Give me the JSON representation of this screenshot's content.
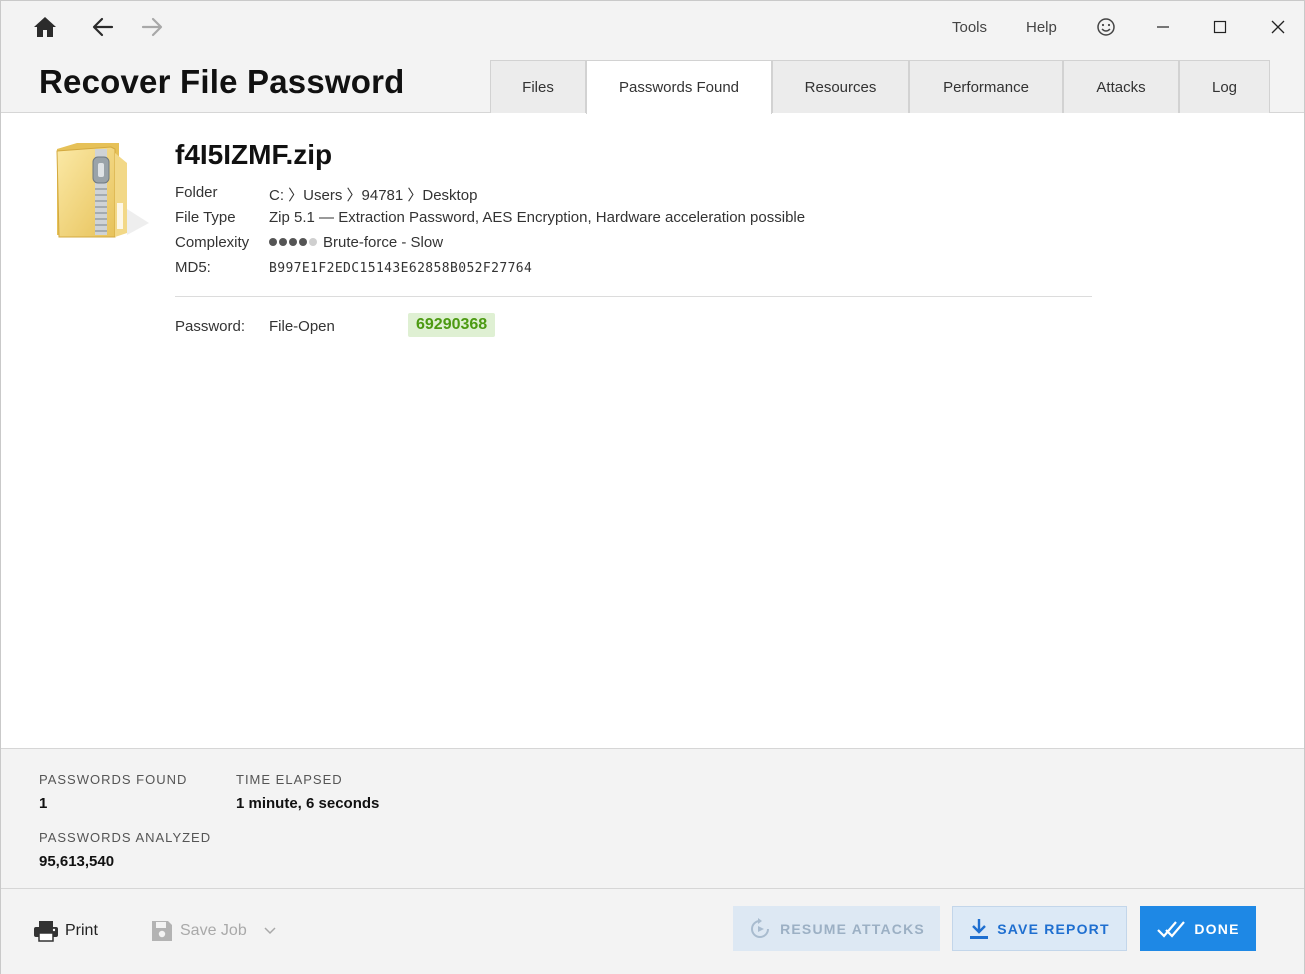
{
  "app": {
    "title": "Recover File Password",
    "menu": {
      "tools": "Tools",
      "help": "Help"
    }
  },
  "tabs": [
    {
      "label": "Files",
      "active": false
    },
    {
      "label": "Passwords Found",
      "active": true
    },
    {
      "label": "Resources",
      "active": false
    },
    {
      "label": "Performance",
      "active": false
    },
    {
      "label": "Attacks",
      "active": false
    },
    {
      "label": "Log",
      "active": false
    }
  ],
  "file": {
    "name": "f4I5IZMF.zip",
    "folder_label": "Folder",
    "folder_value": "C: 〉Users 〉94781 〉Desktop",
    "type_label": "File Type",
    "type_value": "Zip 5.1 — Extraction Password, AES Encryption, Hardware acceleration possible",
    "complexity_label": "Complexity",
    "complexity_level": 4,
    "complexity_max": 5,
    "complexity_value": "Brute-force - Slow",
    "md5_label": "MD5:",
    "md5_value": "B997E1F2EDC15143E62858B052F27764"
  },
  "password": {
    "label": "Password:",
    "kind": "File-Open",
    "value": "69290368"
  },
  "stats": {
    "found_label": "PASSWORDS FOUND",
    "found_value": "1",
    "elapsed_label": "TIME ELAPSED",
    "elapsed_value": "1 minute, 6 seconds",
    "analyzed_label": "PASSWORDS ANALYZED",
    "analyzed_value": "95,613,540"
  },
  "footer": {
    "print_label": "Print",
    "save_job_label": "Save Job",
    "resume_label": "RESUME ATTACKS",
    "save_report_label": "SAVE REPORT",
    "done_label": "DONE"
  },
  "colors": {
    "accent": "#1e88e5",
    "password_text": "#4c9a12",
    "password_bg": "#dff0d3"
  },
  "icons": {
    "home": "home-icon",
    "back": "arrow-left-icon",
    "forward": "arrow-right-icon",
    "feedback": "smiley-icon",
    "file": "zip-folder-icon",
    "print": "printer-icon",
    "save_job": "floppy-disk-icon",
    "resume": "resume-icon",
    "save_report": "download-icon",
    "done": "double-check-icon"
  }
}
